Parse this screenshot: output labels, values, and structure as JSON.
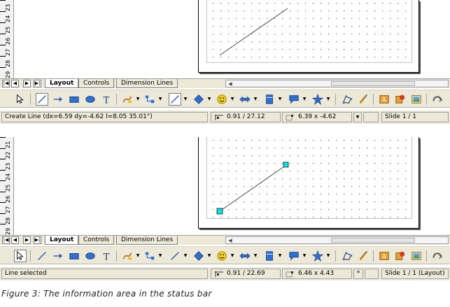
{
  "top": {
    "ruler_numbers": [
      "23",
      "24",
      "25",
      "26",
      "27",
      "28",
      "29"
    ],
    "tabs": [
      {
        "label": "Layout",
        "active": true
      },
      {
        "label": "Controls",
        "active": false
      },
      {
        "label": "Dimension Lines",
        "active": false
      }
    ],
    "status": {
      "message": "Create Line (dx=6.59 dy=-4.62 l=8.05 35.01°)",
      "position": "0.91 / 27.12",
      "size": "6.39 x -4.62",
      "modified": "",
      "slide": "Slide 1 / 1"
    },
    "line_selected": false
  },
  "bottom": {
    "ruler_numbers": [
      "21",
      "22",
      "23",
      "24",
      "25",
      "26",
      "27",
      "28",
      "29"
    ],
    "tabs": [
      {
        "label": "Layout",
        "active": true
      },
      {
        "label": "Controls",
        "active": false
      },
      {
        "label": "Dimension Lines",
        "active": false
      }
    ],
    "status": {
      "message": "Line selected",
      "position": "0.91 / 22.69",
      "size": "6.46 x 4.43",
      "modified": "*",
      "slide": "Slide 1 / 1 (Layout)"
    },
    "line_selected": true
  },
  "toolbar_icons": [
    "select-arrow-icon",
    "line-icon",
    "line-arrow-icon",
    "rectangle-icon",
    "ellipse-icon",
    "text-icon",
    "curve-icon",
    "connector-icon",
    "lines-arrows-icon",
    "basic-shapes-icon",
    "symbol-shapes-icon",
    "block-arrows-icon",
    "flowchart-icon",
    "callouts-icon",
    "stars-icon",
    "points-icon",
    "glue-points-icon",
    "fontwork-icon",
    "from-file-icon",
    "gallery-icon",
    "extrusion-icon"
  ],
  "colors": {
    "chrome": "#ece9d8",
    "grid_dot": "#1a8a1a",
    "handle": "#00e5e5",
    "line_stroke": "#4a4a4a"
  },
  "caption": "Figure 3: The information area in the status bar"
}
